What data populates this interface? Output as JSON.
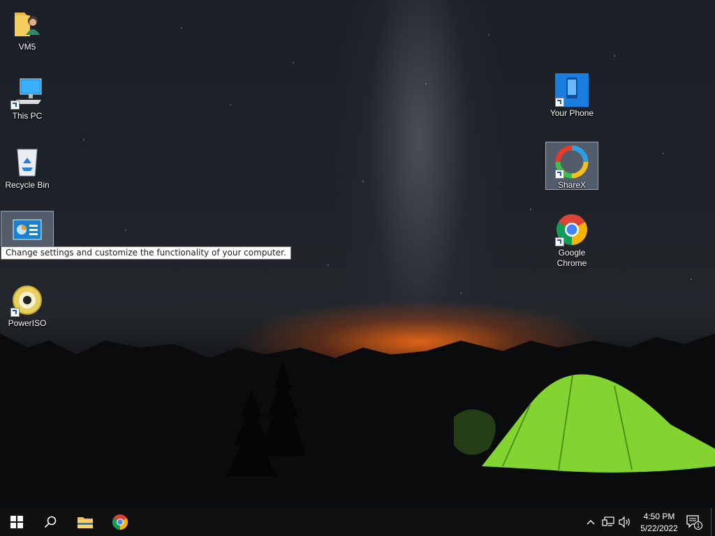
{
  "desktop": {
    "icons": [
      {
        "label": "VM5",
        "icon": "folder-user-icon"
      },
      {
        "label": "This PC",
        "icon": "computer-icon"
      },
      {
        "label": "Recycle Bin",
        "icon": "recycle-bin-icon"
      },
      {
        "label": "",
        "icon": "control-panel-icon"
      },
      {
        "label": "PowerISO",
        "icon": "poweriso-icon"
      },
      {
        "label": "Your Phone",
        "icon": "your-phone-icon"
      },
      {
        "label": "ShareX",
        "icon": "sharex-icon"
      },
      {
        "label": "Google Chrome",
        "icon": "chrome-icon"
      }
    ],
    "tooltip": "Change settings and customize the functionality of your computer."
  },
  "taskbar": {
    "pinned": [
      {
        "name": "start",
        "icon": "windows-icon"
      },
      {
        "name": "search",
        "icon": "search-icon"
      },
      {
        "name": "file-explorer",
        "icon": "folder-icon"
      },
      {
        "name": "chrome",
        "icon": "chrome-icon"
      }
    ],
    "tray": {
      "time": "4:50 PM",
      "date": "5/22/2022",
      "notification_count": "1"
    }
  },
  "colors": {
    "taskbar_bg": "#101010",
    "tent_green": "#8fe635",
    "horizon_orange": "#ff6e14"
  }
}
